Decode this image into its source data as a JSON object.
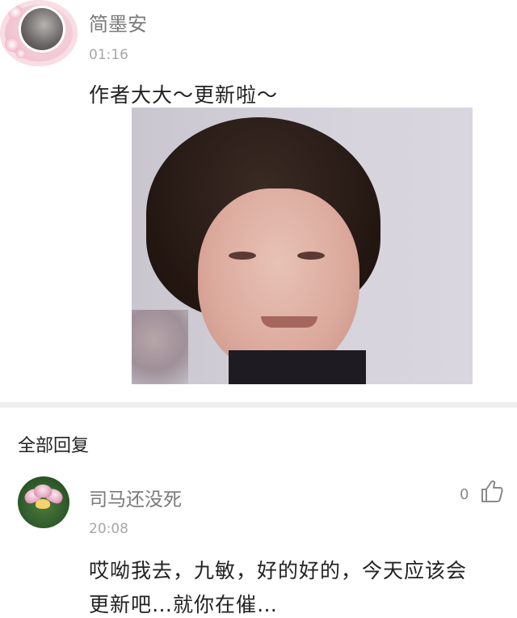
{
  "top_comment": {
    "username": "简墨安",
    "time": "01:16",
    "content": "作者大大～更新啦～",
    "avatar_icon": "profile-avatar",
    "image_icon": "reaction-photo"
  },
  "replies_section": {
    "title": "全部回复"
  },
  "reply": {
    "username": "司马还没死",
    "time": "20:08",
    "likes": "0",
    "like_icon": "thumbs-up-icon",
    "content_line1": "哎呦我去，九敏，好的好的，今天应该会",
    "content_line2": "更新吧…就你在催…"
  },
  "colors": {
    "name_gray": "#7a7a7a",
    "time_gray": "#a7a7a7",
    "text": "#222222",
    "divider": "#efefef"
  }
}
